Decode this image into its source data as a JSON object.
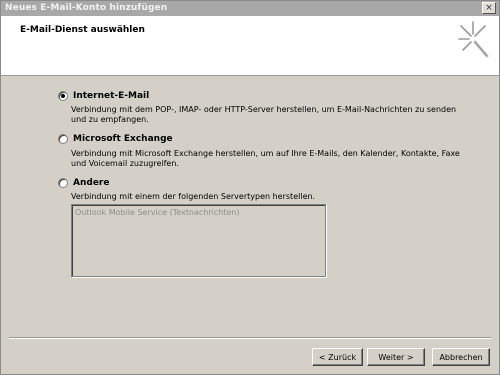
{
  "window": {
    "title": "Neues E-Mail-Konto hinzufügen",
    "close_symbol": "×"
  },
  "header": {
    "title": "E-Mail-Dienst auswählen",
    "logo_icon": "sparkle-icon"
  },
  "options": [
    {
      "label": "Internet-E-Mail",
      "description": "Verbindung mit dem POP-, IMAP- oder HTTP-Server herstellen, um E-Mail-Nachrichten zu senden und zu empfangen.",
      "selected": true
    },
    {
      "label": "Microsoft Exchange",
      "description": "Verbindung mit Microsoft Exchange herstellen, um auf Ihre E-Mails, den Kalender, Kontakte, Faxe und Voicemail zuzugreifen.",
      "selected": false
    },
    {
      "label": "Andere",
      "description": "Verbindung mit einem der folgenden Servertypen herstellen.",
      "selected": false
    }
  ],
  "server_list": {
    "items": [
      "Outlook Mobile Service (Textnachrichten)"
    ]
  },
  "buttons": {
    "back": "< Zurück",
    "next": "Weiter >",
    "cancel": "Abbrechen"
  }
}
